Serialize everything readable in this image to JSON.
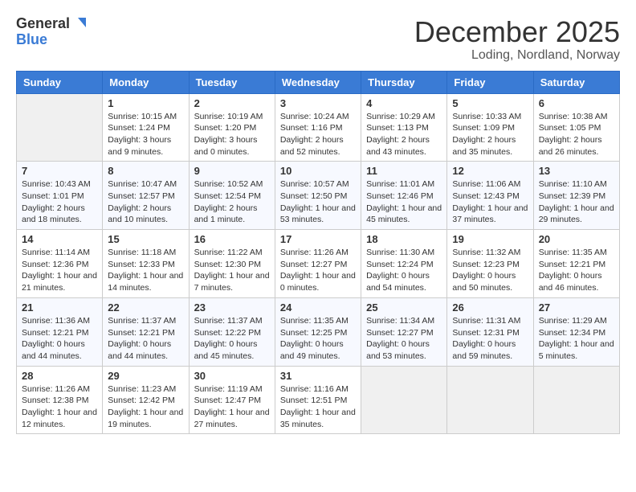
{
  "header": {
    "logo_general": "General",
    "logo_blue": "Blue",
    "month_title": "December 2025",
    "location": "Loding, Nordland, Norway"
  },
  "calendar": {
    "weekdays": [
      "Sunday",
      "Monday",
      "Tuesday",
      "Wednesday",
      "Thursday",
      "Friday",
      "Saturday"
    ],
    "weeks": [
      [
        {
          "day": "",
          "info": ""
        },
        {
          "day": "1",
          "info": "Sunrise: 10:15 AM\nSunset: 1:24 PM\nDaylight: 3 hours and 9 minutes."
        },
        {
          "day": "2",
          "info": "Sunrise: 10:19 AM\nSunset: 1:20 PM\nDaylight: 3 hours and 0 minutes."
        },
        {
          "day": "3",
          "info": "Sunrise: 10:24 AM\nSunset: 1:16 PM\nDaylight: 2 hours and 52 minutes."
        },
        {
          "day": "4",
          "info": "Sunrise: 10:29 AM\nSunset: 1:13 PM\nDaylight: 2 hours and 43 minutes."
        },
        {
          "day": "5",
          "info": "Sunrise: 10:33 AM\nSunset: 1:09 PM\nDaylight: 2 hours and 35 minutes."
        },
        {
          "day": "6",
          "info": "Sunrise: 10:38 AM\nSunset: 1:05 PM\nDaylight: 2 hours and 26 minutes."
        }
      ],
      [
        {
          "day": "7",
          "info": "Sunrise: 10:43 AM\nSunset: 1:01 PM\nDaylight: 2 hours and 18 minutes."
        },
        {
          "day": "8",
          "info": "Sunrise: 10:47 AM\nSunset: 12:57 PM\nDaylight: 2 hours and 10 minutes."
        },
        {
          "day": "9",
          "info": "Sunrise: 10:52 AM\nSunset: 12:54 PM\nDaylight: 2 hours and 1 minute."
        },
        {
          "day": "10",
          "info": "Sunrise: 10:57 AM\nSunset: 12:50 PM\nDaylight: 1 hour and 53 minutes."
        },
        {
          "day": "11",
          "info": "Sunrise: 11:01 AM\nSunset: 12:46 PM\nDaylight: 1 hour and 45 minutes."
        },
        {
          "day": "12",
          "info": "Sunrise: 11:06 AM\nSunset: 12:43 PM\nDaylight: 1 hour and 37 minutes."
        },
        {
          "day": "13",
          "info": "Sunrise: 11:10 AM\nSunset: 12:39 PM\nDaylight: 1 hour and 29 minutes."
        }
      ],
      [
        {
          "day": "14",
          "info": "Sunrise: 11:14 AM\nSunset: 12:36 PM\nDaylight: 1 hour and 21 minutes."
        },
        {
          "day": "15",
          "info": "Sunrise: 11:18 AM\nSunset: 12:33 PM\nDaylight: 1 hour and 14 minutes."
        },
        {
          "day": "16",
          "info": "Sunrise: 11:22 AM\nSunset: 12:30 PM\nDaylight: 1 hour and 7 minutes."
        },
        {
          "day": "17",
          "info": "Sunrise: 11:26 AM\nSunset: 12:27 PM\nDaylight: 1 hour and 0 minutes."
        },
        {
          "day": "18",
          "info": "Sunrise: 11:30 AM\nSunset: 12:24 PM\nDaylight: 0 hours and 54 minutes."
        },
        {
          "day": "19",
          "info": "Sunrise: 11:32 AM\nSunset: 12:23 PM\nDaylight: 0 hours and 50 minutes."
        },
        {
          "day": "20",
          "info": "Sunrise: 11:35 AM\nSunset: 12:21 PM\nDaylight: 0 hours and 46 minutes."
        }
      ],
      [
        {
          "day": "21",
          "info": "Sunrise: 11:36 AM\nSunset: 12:21 PM\nDaylight: 0 hours and 44 minutes."
        },
        {
          "day": "22",
          "info": "Sunrise: 11:37 AM\nSunset: 12:21 PM\nDaylight: 0 hours and 44 minutes."
        },
        {
          "day": "23",
          "info": "Sunrise: 11:37 AM\nSunset: 12:22 PM\nDaylight: 0 hours and 45 minutes."
        },
        {
          "day": "24",
          "info": "Sunrise: 11:35 AM\nSunset: 12:25 PM\nDaylight: 0 hours and 49 minutes."
        },
        {
          "day": "25",
          "info": "Sunrise: 11:34 AM\nSunset: 12:27 PM\nDaylight: 0 hours and 53 minutes."
        },
        {
          "day": "26",
          "info": "Sunrise: 11:31 AM\nSunset: 12:31 PM\nDaylight: 0 hours and 59 minutes."
        },
        {
          "day": "27",
          "info": "Sunrise: 11:29 AM\nSunset: 12:34 PM\nDaylight: 1 hour and 5 minutes."
        }
      ],
      [
        {
          "day": "28",
          "info": "Sunrise: 11:26 AM\nSunset: 12:38 PM\nDaylight: 1 hour and 12 minutes."
        },
        {
          "day": "29",
          "info": "Sunrise: 11:23 AM\nSunset: 12:42 PM\nDaylight: 1 hour and 19 minutes."
        },
        {
          "day": "30",
          "info": "Sunrise: 11:19 AM\nSunset: 12:47 PM\nDaylight: 1 hour and 27 minutes."
        },
        {
          "day": "31",
          "info": "Sunrise: 11:16 AM\nSunset: 12:51 PM\nDaylight: 1 hour and 35 minutes."
        },
        {
          "day": "",
          "info": ""
        },
        {
          "day": "",
          "info": ""
        },
        {
          "day": "",
          "info": ""
        }
      ]
    ]
  }
}
